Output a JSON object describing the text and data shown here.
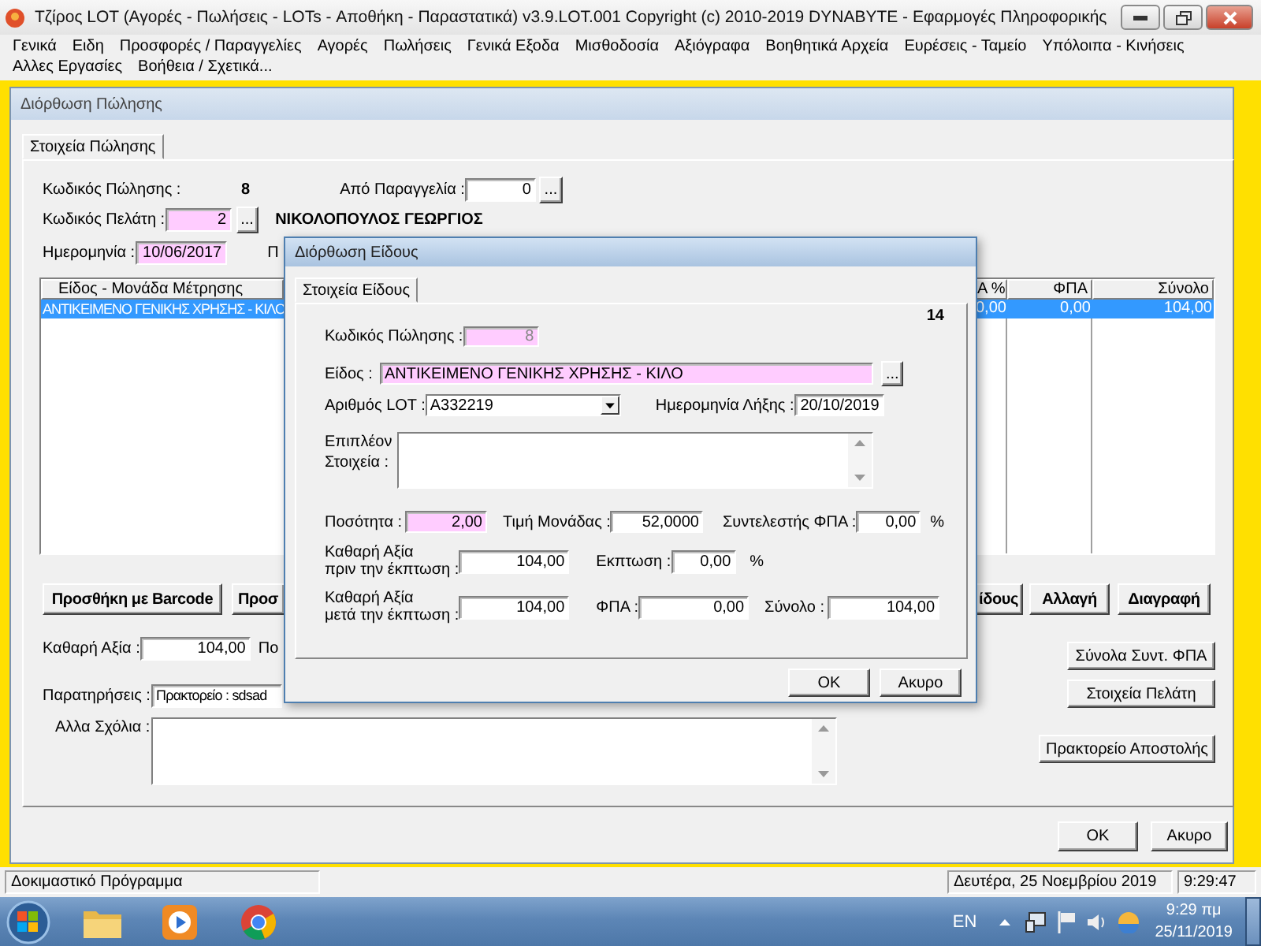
{
  "app_window": {
    "title": "Τζίρος LOT (Αγορές - Πωλήσεις - LOTs - Αποθήκη - Παραστατικά)  v3.9.LOT.001   Copyright (c) 2010-2019  DYNABYTE - Εφαρμογές Πληροφορικής"
  },
  "menu_rows": [
    [
      "Γενικά",
      "Ειδη",
      "Προσφορές / Παραγγελίες",
      "Αγορές",
      "Πωλήσεις",
      "Γενικά Εξοδα",
      "Μισθοδοσία",
      "Αξιόγραφα",
      "Βοηθητικά Αρχεία",
      "Ευρέσεις - Ταμείο",
      "Υπόλοιπα - Κινήσεις"
    ],
    [
      "Αλλες Εργασίες",
      "Βοήθεια / Σχετικά..."
    ]
  ],
  "sale_window": {
    "title": "Διόρθωση Πώλησης",
    "tabs": [
      {
        "label": "Στοιχεία Πώλησης",
        "selected": true
      }
    ],
    "sale_code": {
      "label": "Κωδικός Πώλησης :",
      "value": "8"
    },
    "order": {
      "label": "Από Παραγγελία :",
      "value": "0",
      "button": "..."
    },
    "customer": {
      "label": "Κωδικός Πελάτη :",
      "value": "2",
      "required": true,
      "button": "...",
      "name": "ΝΙΚΟΛΟΠΟΥΛΟΣ ΓΕΩΡΓΙΟΣ"
    },
    "date": {
      "label": "Ημερομηνία :",
      "value": "10/06/2017",
      "required": true,
      "cut_label": "Π"
    },
    "table": {
      "columns": [
        "Είδος - Μονάδα Μέτρησης",
        "Α %",
        "ΦΠΑ",
        "Σύνολο"
      ],
      "rows": [
        {
          "cells": [
            "ΑΝΤΙΚΕΙΜΕΝΟ ΓΕΝΙΚΗΣ ΧΡΗΣΗΣ - ΚΙΛΟ",
            "0,00",
            "0,00",
            "104,00"
          ],
          "selected": true
        }
      ]
    },
    "left_buttons": [
      "Προσθήκη με Barcode",
      "Προσ"
    ],
    "right_buttons": [
      "ίδους",
      "Αλλαγή",
      "Διαγραφή"
    ],
    "net_value": {
      "label": "Καθαρή Αξία :",
      "value": "104,00",
      "cut_label": "Πο"
    },
    "notes": {
      "label": "Παρατηρήσεις :",
      "value": "Πρακτορείο : sdsad"
    },
    "comments": {
      "label": "Αλλα Σχόλια :"
    },
    "side_buttons": [
      "Σύνολα Συντ. ΦΠΑ",
      "Στοιχεία Πελάτη",
      "Πρακτορείο Αποστολής"
    ],
    "footer_buttons": [
      "OK",
      "Ακυρο"
    ]
  },
  "dialog": {
    "title": "Διόρθωση Είδους",
    "tabs": [
      {
        "label": "Στοιχεία Είδους",
        "selected": true
      }
    ],
    "record_number": "14",
    "sale_code": {
      "label": "Κωδικός Πώλησης :",
      "value": "8",
      "required": true,
      "disabled": true
    },
    "item": {
      "label": "Είδος :",
      "value": "ΑΝΤΙΚΕΙΜΕΝΟ ΓΕΝΙΚΗΣ ΧΡΗΣΗΣ - ΚΙΛΟ",
      "required": true,
      "button": "..."
    },
    "lot": {
      "label": "Αριθμός LOT :",
      "value": "A332219"
    },
    "expiry": {
      "label": "Ημερομηνία Λήξης :",
      "value": "20/10/2019"
    },
    "extra": {
      "label": "Επιπλέον\nΣτοιχεία :"
    },
    "quantity": {
      "label": "Ποσότητα :",
      "value": "2,00",
      "required": true
    },
    "unit_price": {
      "label": "Τιμή Μονάδας :",
      "value": "52,0000"
    },
    "vat_rate": {
      "label": "Συντελεστής ΦΠΑ :",
      "value": "0,00",
      "unit": "%"
    },
    "net_before": {
      "label": "Καθαρή Αξία\nπριν την έκπτωση :",
      "value": "104,00"
    },
    "discount": {
      "label": "Εκπτωση :",
      "value": "0,00",
      "unit": "%"
    },
    "net_after": {
      "label": "Καθαρή Αξία\nμετά την έκπτωση :",
      "value": "104,00"
    },
    "vat": {
      "label": "ΦΠΑ :",
      "value": "0,00"
    },
    "total": {
      "label": "Σύνολο :",
      "value": "104,00"
    },
    "buttons": [
      "OK",
      "Ακυρο"
    ]
  },
  "status_bar": {
    "message": "Δοκιμαστικό Πρόγραμμα",
    "date": "Δευτέρα, 25 Νοεμβρίου 2019",
    "time": "9:29:47"
  },
  "taskbar": {
    "language": "EN",
    "time": "9:29 πμ",
    "date": "25/11/2019"
  }
}
